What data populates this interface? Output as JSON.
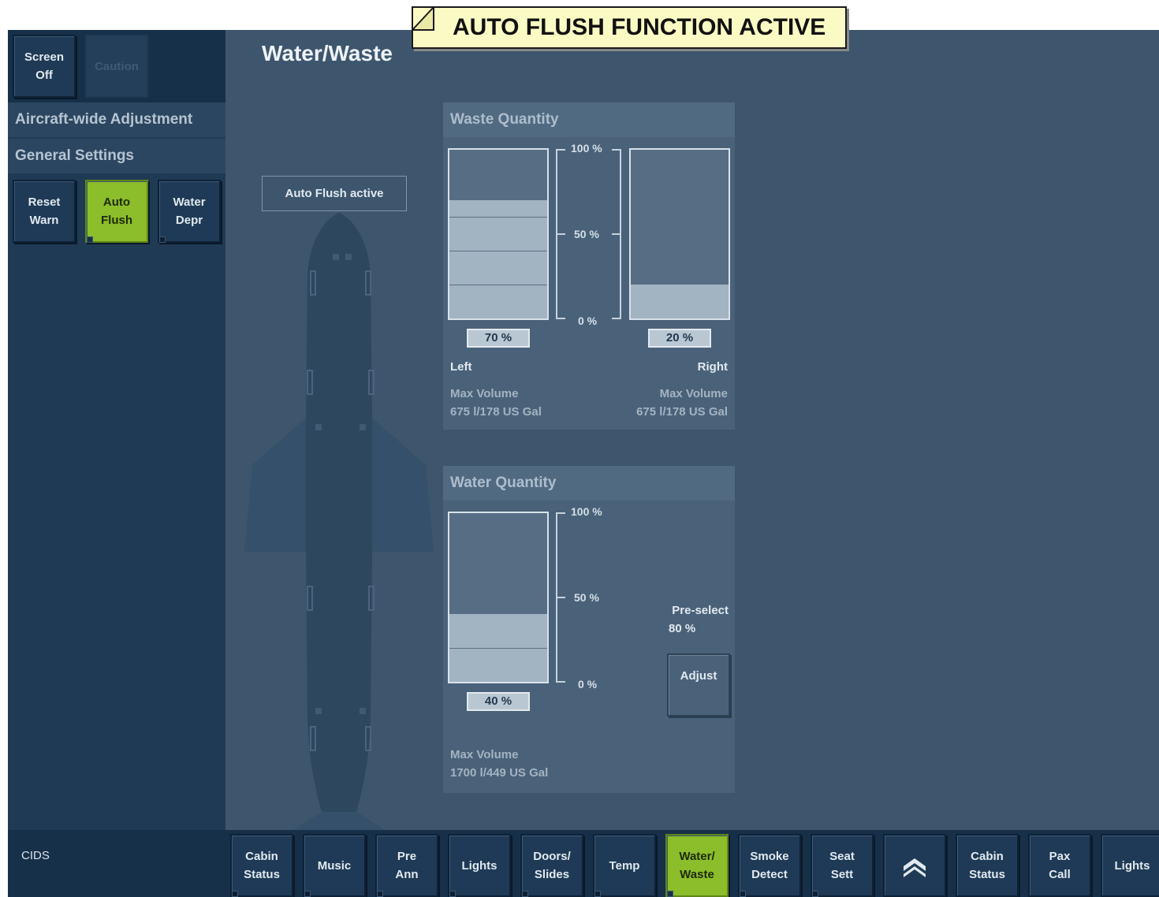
{
  "banner": {
    "text": "AUTO FLUSH FUNCTION ACTIVE"
  },
  "header_buttons": [
    {
      "label": "Screen\nOff",
      "state": "normal"
    },
    {
      "label": "Caution",
      "state": "disabled"
    }
  ],
  "sidebar": {
    "section1": "Aircraft-wide Adjustment",
    "section2": "General Settings",
    "buttons": [
      {
        "label": "Reset\nWarn",
        "active": false
      },
      {
        "label": "Auto\nFlush",
        "active": true
      },
      {
        "label": "Water\nDepr",
        "active": false
      }
    ]
  },
  "page": {
    "title": "Water/Waste",
    "auto_flush_status": "Auto Flush active"
  },
  "waste": {
    "title": "Waste Quantity",
    "scale": [
      "100 %",
      "50 %",
      "0 %"
    ],
    "left": {
      "label": "Left",
      "percent": 70,
      "percent_text": "70 %",
      "max_volume_label": "Max Volume",
      "max_volume_value": "675 l/178 US Gal"
    },
    "right": {
      "label": "Right",
      "percent": 20,
      "percent_text": "20 %",
      "max_volume_label": "Max Volume",
      "max_volume_value": "675 l/178 US Gal"
    }
  },
  "water": {
    "title": "Water Quantity",
    "scale": [
      "100 %",
      "50 %",
      "0 %"
    ],
    "percent": 40,
    "percent_text": "40 %",
    "preselect_label": "Pre-select",
    "preselect_value": "80 %",
    "adjust_label": "Adjust",
    "max_volume_label": "Max Volume",
    "max_volume_value": "1700 l/449 US Gal"
  },
  "bottom": {
    "system_label": "CIDS",
    "tabs": [
      {
        "label": "Cabin\nStatus",
        "active": false
      },
      {
        "label": "Music",
        "active": false
      },
      {
        "label": "Pre\nAnn",
        "active": false
      },
      {
        "label": "Lights",
        "active": false
      },
      {
        "label": "Doors/\nSlides",
        "active": false
      },
      {
        "label": "Temp",
        "active": false
      },
      {
        "label": "Water/\nWaste",
        "active": true
      },
      {
        "label": "Smoke\nDetect",
        "active": false
      },
      {
        "label": "Seat\nSett",
        "active": false
      },
      {
        "label": "",
        "icon": "double-chevron-up-icon",
        "active": false
      },
      {
        "label": "Cabin\nStatus",
        "active": false
      },
      {
        "label": "Pax\nCall",
        "active": false
      },
      {
        "label": "Lights",
        "active": false
      }
    ]
  },
  "colors": {
    "background": "#3d566e",
    "sidebar": "#1f3a55",
    "active_green": "#8cbd2a",
    "banner_yellow": "#fafac4"
  }
}
